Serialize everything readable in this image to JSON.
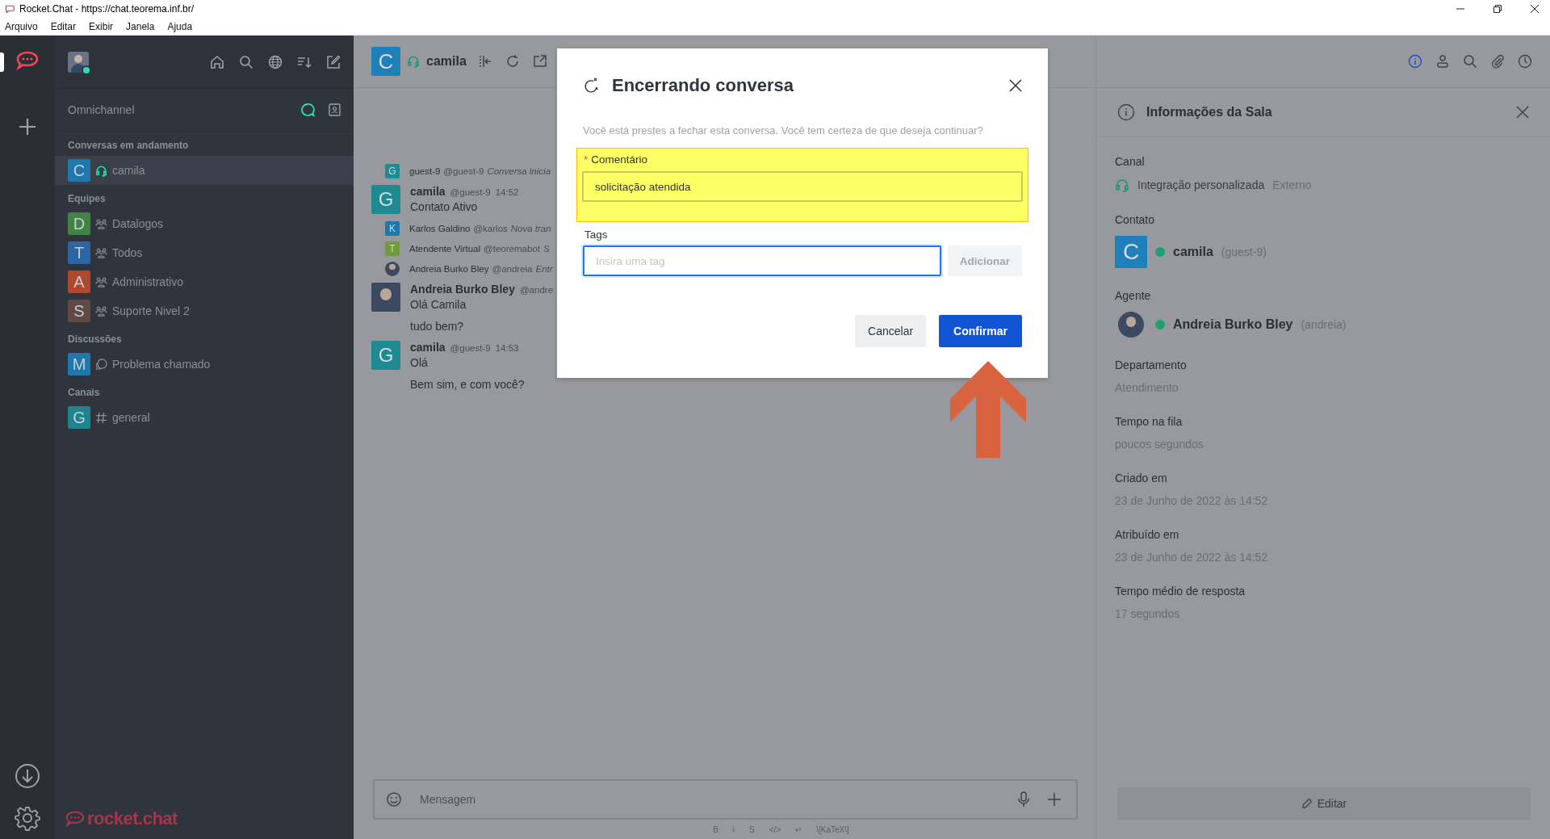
{
  "window": {
    "title": "Rocket.Chat - https://chat.teorema.inf.br/",
    "menu": [
      "Arquivo",
      "Editar",
      "Exibir",
      "Janela",
      "Ajuda"
    ]
  },
  "rail": {
    "brand": "rocket.chat"
  },
  "sidebar": {
    "section_title": "Omnichannel",
    "groups": [
      {
        "title": "Conversas em andamento",
        "items": [
          {
            "initial": "C",
            "color": "#1f78ad",
            "kind": "livechat",
            "name": "camila",
            "selected": true
          }
        ]
      },
      {
        "title": "Equipes",
        "items": [
          {
            "initial": "D",
            "color": "#3f8445",
            "kind": "team",
            "name": "Datalogos",
            "selected": false
          },
          {
            "initial": "T",
            "color": "#2a66a3",
            "kind": "team",
            "name": "Todos",
            "selected": false
          },
          {
            "initial": "A",
            "color": "#ad4a2e",
            "kind": "team",
            "name": "Administrativo",
            "selected": false
          },
          {
            "initial": "S",
            "color": "#5f4a45",
            "kind": "team",
            "name": "Suporte Nivel 2",
            "selected": false
          }
        ]
      },
      {
        "title": "Discussões",
        "items": [
          {
            "initial": "M",
            "color": "#1f78ad",
            "kind": "discussion",
            "name": "Problema chamado",
            "selected": false
          }
        ]
      },
      {
        "title": "Canais",
        "items": [
          {
            "initial": "G",
            "color": "#1e8590",
            "kind": "channel",
            "name": "general",
            "selected": false
          }
        ]
      }
    ]
  },
  "room_header": {
    "initial": "C",
    "color": "#1f7fb8",
    "name": "camila"
  },
  "messages": [
    {
      "kind": "system",
      "initial": "G",
      "color": "#1e8a92",
      "author": "guest-9",
      "username": "@guest-9",
      "text": "Conversa inicia"
    },
    {
      "kind": "message",
      "initial": "G",
      "color": "#1e8a92",
      "author": "camila",
      "username": "@guest-9",
      "time": "14:52",
      "lines": [
        "Contato Ativo"
      ]
    },
    {
      "kind": "system",
      "initial": "K",
      "color": "#1f78ad",
      "author": "Karlos Galdino",
      "username": "@karlos",
      "text": "Nova tran"
    },
    {
      "kind": "system",
      "initial": "T",
      "color": "#6f9a3e",
      "author": "Atendente Virtual",
      "username": "@teoremabot",
      "text": "S"
    },
    {
      "kind": "system",
      "author": "Andreia Burko Bley",
      "username": "@andreia",
      "text": "Entr"
    },
    {
      "kind": "message",
      "author": "Andreia Burko Bley",
      "username": "@andre",
      "lines": [
        "Olá Camila",
        "tudo bem?"
      ]
    },
    {
      "kind": "message",
      "initial": "G",
      "color": "#1e8a92",
      "author": "camila",
      "username": "@guest-9",
      "time": "14:53",
      "lines": [
        "Olá",
        "Bem sim, e com você?"
      ]
    }
  ],
  "composer": {
    "placeholder": "Mensagem",
    "format_buttons": [
      "B",
      "i",
      "S",
      "</>",
      "↵",
      "\\[KaTeX\\]"
    ]
  },
  "modal": {
    "title": "Encerrando conversa",
    "description": "Você está prestes a fechar esta conversa. Você tem certeza de que deseja continuar?",
    "comment": {
      "label": "Comentário",
      "required_mark": "*",
      "value": "solicitação atendida"
    },
    "tags": {
      "label": "Tags",
      "placeholder": "Insira uma tag",
      "add_button": "Adicionar",
      "add_disabled": true
    },
    "cancel": "Cancelar",
    "confirm": "Confirmar"
  },
  "room_info": {
    "title": "Informações da Sala",
    "fields": [
      {
        "kind": "channel",
        "label": "Canal",
        "value": "Integração personalizada",
        "note": "Externo"
      },
      {
        "kind": "contact",
        "label": "Contato",
        "initial": "C",
        "color": "#1f7fb8",
        "name": "camila",
        "username": "(guest-9)",
        "online": true
      },
      {
        "kind": "agent",
        "label": "Agente",
        "name": "Andreia Burko Bley",
        "username": "(andreia)",
        "online": true
      },
      {
        "kind": "text",
        "label": "Departamento",
        "value": "Atendimento"
      },
      {
        "kind": "text",
        "label": "Tempo na fila",
        "value": "poucos segundos"
      },
      {
        "kind": "text",
        "label": "Criado em",
        "value": "23 de Junho de 2022 às 14:52"
      },
      {
        "kind": "text",
        "label": "Atribuído em",
        "value": "23 de Junho de 2022 às 14:52"
      },
      {
        "kind": "text",
        "label": "Tempo médio de resposta",
        "value": "17 segundos"
      }
    ],
    "edit_button": "Editar"
  }
}
